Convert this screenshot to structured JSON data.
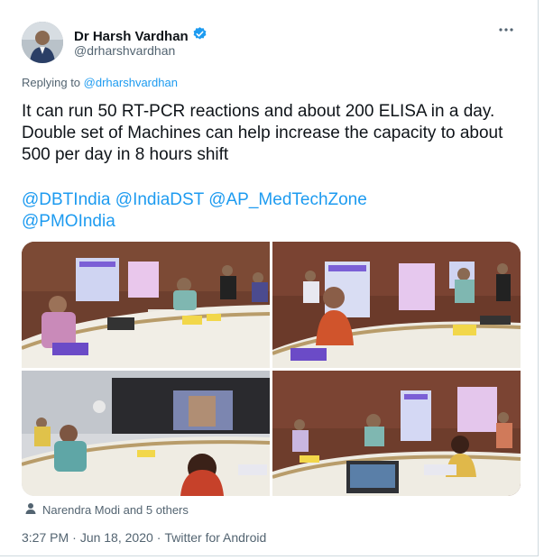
{
  "author": {
    "name": "Dr Harsh Vardhan",
    "handle": "@drharshvardhan",
    "verified": true,
    "badge_color": "#1d9bf0"
  },
  "more_icon": "ellipsis-icon",
  "replying": {
    "prefix": "Replying to",
    "handle": "@drharshvardhan"
  },
  "tweet": {
    "text": "It can run 50 RT-PCR reactions and about 200 ELISA in a day. Double set of Machines can help increase the capacity to about 500 per day in 8 hours shift",
    "mentions": [
      "@DBTIndia",
      "@IndiaDST",
      "@AP_MedTechZone",
      "@PMOIndia"
    ]
  },
  "likes_row": {
    "icon": "person-icon",
    "text": "Narendra Modi and 5 others"
  },
  "meta": {
    "time": "3:27 PM",
    "separator1": "·",
    "date": "Jun 18, 2020",
    "separator2": "·",
    "source": "Twitter for Android"
  },
  "colors": {
    "link": "#1d9bf0",
    "secondary_text": "#536471",
    "primary_text": "#0f1419"
  }
}
